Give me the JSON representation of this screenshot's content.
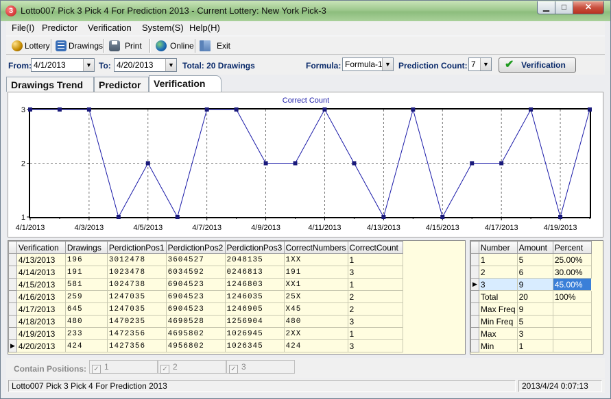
{
  "window": {
    "title": "Lotto007 Pick 3 Pick 4 For Prediction 2013 - Current Lottery: New York Pick-3",
    "icon_glyph": "3",
    "min_glyph": "▁",
    "max_glyph": "□",
    "close_glyph": "✕"
  },
  "menu": [
    "File(I)",
    "Predictor",
    "Verification",
    "System(S)",
    "Help(H)"
  ],
  "toolbar": {
    "lottery": "Lottery",
    "drawings": "Drawings",
    "print": "Print",
    "online": "Online",
    "exit": "Exit"
  },
  "filter": {
    "from_label": "From:",
    "from_value": "4/1/2013",
    "to_label": "To:",
    "to_value": "4/20/2013",
    "total": "Total: 20 Drawings",
    "formula_label": "Formula:",
    "formula_value": "Formula-1",
    "count_label": "Prediction Count:",
    "count_value": "7",
    "verify_button": "Verification",
    "verify_glyph": "✔",
    "dropdown_glyph": "▼"
  },
  "tabs": [
    "Drawings Trend",
    "Predictor",
    "Verification"
  ],
  "chart_data": {
    "type": "line",
    "title": "Correct Count",
    "color": "#1a1aa8",
    "xlabel": "",
    "ylabel": "",
    "ylim": [
      1,
      3
    ],
    "yticks": [
      1,
      2,
      3
    ],
    "xtick_labels": [
      "4/1/2013",
      "4/3/2013",
      "4/5/2013",
      "4/7/2013",
      "4/9/2013",
      "4/11/2013",
      "4/13/2013",
      "4/15/2013",
      "4/17/2013",
      "4/19/2013"
    ],
    "x": [
      "4/1/2013",
      "4/2/2013",
      "4/3/2013",
      "4/4/2013",
      "4/5/2013",
      "4/6/2013",
      "4/7/2013",
      "4/8/2013",
      "4/9/2013",
      "4/10/2013",
      "4/11/2013",
      "4/12/2013",
      "4/13/2013",
      "4/14/2013",
      "4/15/2013",
      "4/16/2013",
      "4/17/2013",
      "4/18/2013",
      "4/19/2013",
      "4/20/2013"
    ],
    "values": [
      3,
      3,
      3,
      1,
      2,
      1,
      3,
      3,
      2,
      2,
      3,
      2,
      1,
      3,
      1,
      2,
      2,
      3,
      1,
      3
    ],
    "grid": true
  },
  "verification_table": {
    "headers": [
      "Verification",
      "Drawings",
      "PerdictionPos1",
      "PerdictionPos2",
      "PerdictionPos3",
      "CorrectNumbers",
      "CorrectCount"
    ],
    "rows": [
      [
        "4/13/2013",
        "196",
        "3012478",
        "3604527",
        "2048135",
        "1XX",
        "1"
      ],
      [
        "4/14/2013",
        "191",
        "1023478",
        "6034592",
        "0246813",
        "191",
        "3"
      ],
      [
        "4/15/2013",
        "581",
        "1024738",
        "6904523",
        "1246803",
        "XX1",
        "1"
      ],
      [
        "4/16/2013",
        "259",
        "1247035",
        "6904523",
        "1246035",
        "25X",
        "2"
      ],
      [
        "4/17/2013",
        "645",
        "1247035",
        "6904523",
        "1246905",
        "X45",
        "2"
      ],
      [
        "4/18/2013",
        "480",
        "1470235",
        "4690528",
        "1256904",
        "480",
        "3"
      ],
      [
        "4/19/2013",
        "233",
        "1472356",
        "4695802",
        "1026945",
        "2XX",
        "1"
      ],
      [
        "4/20/2013",
        "424",
        "1427356",
        "4956802",
        "1026345",
        "424",
        "3"
      ]
    ],
    "current_row_glyph": "▶"
  },
  "stats_table": {
    "headers": [
      "Number",
      "Amount",
      "Percent"
    ],
    "rows": [
      [
        "1",
        "5",
        "25.00%"
      ],
      [
        "2",
        "6",
        "30.00%"
      ],
      [
        "3",
        "9",
        "45.00%"
      ],
      [
        "Total",
        "20",
        "100%"
      ],
      [
        "Max Freq",
        "9",
        ""
      ],
      [
        "Min Freq",
        "5",
        ""
      ],
      [
        "Max",
        "3",
        ""
      ],
      [
        "Min",
        "1",
        ""
      ]
    ]
  },
  "contain": {
    "label": "Contain Positions:",
    "options": [
      "1",
      "2",
      "3"
    ],
    "check_glyph": "✓"
  },
  "status": {
    "left": "Lotto007 Pick 3 Pick 4 For Prediction 2013",
    "right": "2013/4/24 0:07:13"
  }
}
